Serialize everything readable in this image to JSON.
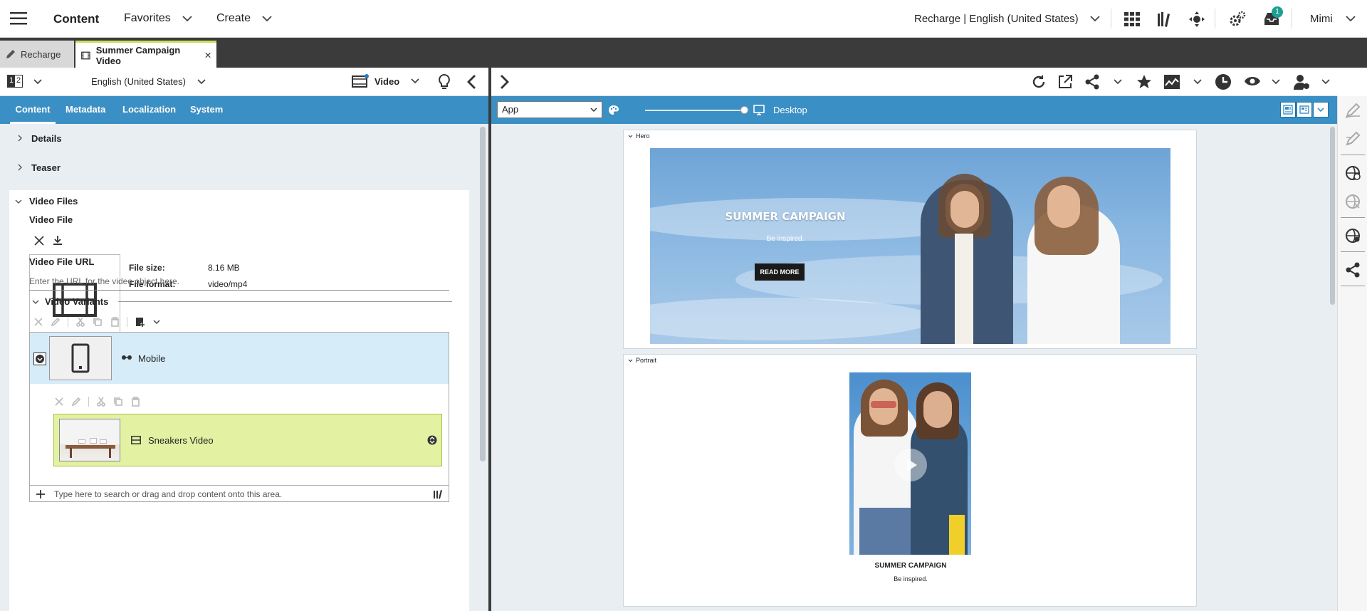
{
  "topbar": {
    "app_title": "Content",
    "favorites_label": "Favorites",
    "create_label": "Create",
    "site_selector": "Recharge | English (United States)",
    "notification_count": "1",
    "user_name": "Mimi"
  },
  "tabs": [
    {
      "label": "Recharge",
      "active": false
    },
    {
      "label": "Summer Campaign Video",
      "active": true
    }
  ],
  "left_toolbar": {
    "version_indicator": "1|2",
    "locale": "English (United States)",
    "doctype": "Video"
  },
  "form_tabs": [
    "Content",
    "Metadata",
    "Localization",
    "System"
  ],
  "form": {
    "details_label": "Details",
    "teaser_label": "Teaser",
    "video_files_label": "Video Files",
    "video_file_label": "Video File",
    "file_size_label": "File size:",
    "file_size_value": "8.16 MB",
    "file_format_label": "File format:",
    "file_format_value": "video/mp4",
    "video_url_label": "Video File URL",
    "video_url_placeholder": "Enter the URL for the video object here.",
    "variants_label": "Video Variants",
    "variant_name": "Mobile",
    "linked_item_name": "Sneakers Video",
    "drop_placeholder": "Type here to search or drag and drop content onto this area."
  },
  "preview": {
    "channel_select": "App",
    "device_label": "Desktop",
    "hero_label": "Hero",
    "hero_headline": "SUMMER CAMPAIGN",
    "hero_subline": "Be inspired.",
    "hero_button": "READ MORE",
    "portrait_label": "Portrait",
    "portrait_headline": "SUMMER CAMPAIGN",
    "portrait_subline": "Be inspired."
  },
  "colors": {
    "accent_blue": "#3a8fc4",
    "active_tab_lime": "#e3f0a8",
    "selected_row": "#d6ecf9",
    "linked_item_bg": "#e3f1a3",
    "badge_teal": "#1f9e92"
  }
}
